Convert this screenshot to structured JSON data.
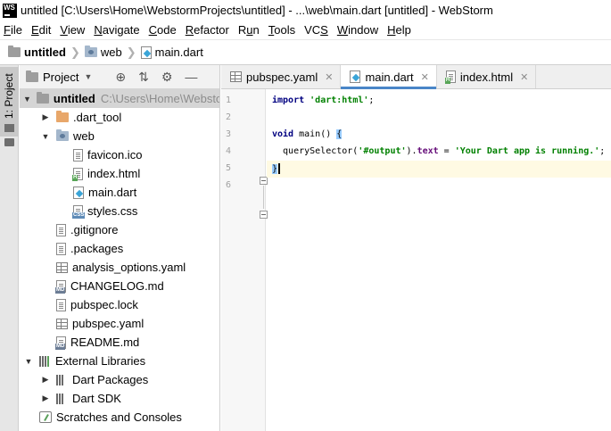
{
  "window": {
    "logo_text": "WS",
    "title": "untitled [C:\\Users\\Home\\WebstormProjects\\untitled] - ...\\web\\main.dart [untitled] - WebStorm"
  },
  "menu": {
    "items": [
      {
        "label": "File",
        "key": "F"
      },
      {
        "label": "Edit",
        "key": "E"
      },
      {
        "label": "View",
        "key": "V"
      },
      {
        "label": "Navigate",
        "key": "N"
      },
      {
        "label": "Code",
        "key": "C"
      },
      {
        "label": "Refactor",
        "key": "R"
      },
      {
        "label": "Run",
        "key": "u"
      },
      {
        "label": "Tools",
        "key": "T"
      },
      {
        "label": "VCS",
        "key": "S"
      },
      {
        "label": "Window",
        "key": "W"
      },
      {
        "label": "Help",
        "key": "H"
      }
    ]
  },
  "breadcrumbs": [
    "untitled",
    "web",
    "main.dart"
  ],
  "toolstrip": {
    "project_tab_label": "1: Project"
  },
  "project_panel": {
    "title": "Project",
    "tree": [
      {
        "label": "untitled",
        "path": "C:\\Users\\Home\\WebstormProjects\\untitled",
        "icon": "folder-gray-icon",
        "depth": 0,
        "arrow": "expanded",
        "selected": true,
        "bold": true
      },
      {
        "label": ".dart_tool",
        "icon": "folder-orange-icon",
        "depth": 1,
        "arrow": "collapsed"
      },
      {
        "label": "web",
        "icon": "folder-web-icon",
        "depth": 1,
        "arrow": "expanded"
      },
      {
        "label": "favicon.ico",
        "icon": "file-icon",
        "depth": 2
      },
      {
        "label": "index.html",
        "icon": "html-file-icon",
        "depth": 2
      },
      {
        "label": "main.dart",
        "icon": "dart-file-icon",
        "depth": 2
      },
      {
        "label": "styles.css",
        "icon": "css-file-icon",
        "depth": 2
      },
      {
        "label": ".gitignore",
        "icon": "file-icon",
        "depth": 1
      },
      {
        "label": ".packages",
        "icon": "file-icon",
        "depth": 1
      },
      {
        "label": "analysis_options.yaml",
        "icon": "yaml-file-icon",
        "depth": 1
      },
      {
        "label": "CHANGELOG.md",
        "icon": "md-file-icon",
        "depth": 1
      },
      {
        "label": "pubspec.lock",
        "icon": "file-icon",
        "depth": 1
      },
      {
        "label": "pubspec.yaml",
        "icon": "yaml-file-icon",
        "depth": 1
      },
      {
        "label": "README.md",
        "icon": "md-file-icon",
        "depth": 1
      },
      {
        "label": "External Libraries",
        "icon": "library-icon",
        "depth": 0,
        "arrow": "expanded"
      },
      {
        "label": "Dart Packages",
        "icon": "library-gray-icon",
        "depth": 1,
        "arrow": "collapsed"
      },
      {
        "label": "Dart SDK",
        "icon": "library-gray-icon",
        "depth": 1,
        "arrow": "collapsed"
      },
      {
        "label": "Scratches and Consoles",
        "icon": "scratch-icon",
        "depth": 0
      }
    ]
  },
  "editor": {
    "tabs": [
      {
        "label": "pubspec.yaml",
        "icon": "yaml-file-icon",
        "active": false
      },
      {
        "label": "main.dart",
        "icon": "dart-file-icon",
        "active": true
      },
      {
        "label": "index.html",
        "icon": "html-file-icon",
        "active": false
      }
    ],
    "line_numbers": [
      "1",
      "2",
      "3",
      "4",
      "5",
      "6"
    ],
    "code": {
      "line1_kw": "import",
      "line1_str": "'dart:html'",
      "line1_end": ";",
      "line3_kw": "void",
      "line3_rest": " main() ",
      "line3_brace": "{",
      "line4_call": "  querySelector(",
      "line4_arg": "'#output'",
      "line4_mid": ").",
      "line4_field": "text",
      "line4_eq": " = ",
      "line4_str": "'Your Dart app is running.'",
      "line4_end": ";",
      "line5_brace": "}"
    }
  }
}
